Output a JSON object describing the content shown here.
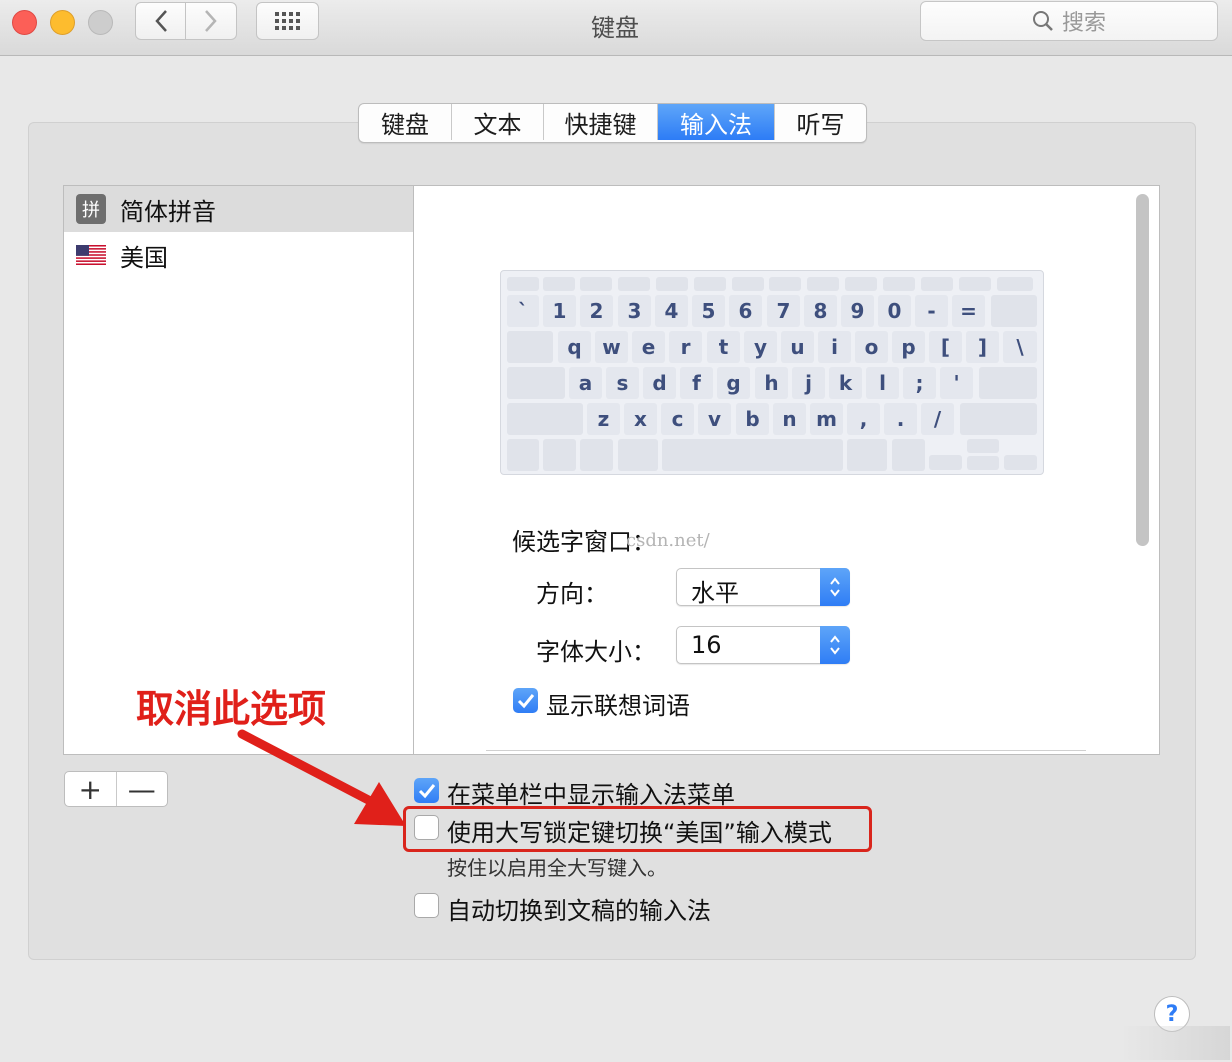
{
  "window": {
    "title": "键盘"
  },
  "search": {
    "placeholder": "搜索"
  },
  "tabs": [
    {
      "label": "键盘"
    },
    {
      "label": "文本"
    },
    {
      "label": "快捷键"
    },
    {
      "label": "输入法"
    },
    {
      "label": "听写"
    }
  ],
  "active_tab": "输入法",
  "input_sources": [
    {
      "icon": "pinyin-icon",
      "icon_text": "拼",
      "label": "简体拼音",
      "selected": true
    },
    {
      "icon": "us-flag-icon",
      "label": "美国",
      "selected": false
    }
  ],
  "keyboard": {
    "row1": [
      "`",
      "1",
      "2",
      "3",
      "4",
      "5",
      "6",
      "7",
      "8",
      "9",
      "0",
      "-",
      "="
    ],
    "row2": [
      "q",
      "w",
      "e",
      "r",
      "t",
      "y",
      "u",
      "i",
      "o",
      "p",
      "[",
      "]",
      "\\"
    ],
    "row3": [
      "a",
      "s",
      "d",
      "f",
      "g",
      "h",
      "j",
      "k",
      "l",
      ";",
      "'"
    ],
    "row4": [
      "z",
      "x",
      "c",
      "v",
      "b",
      "n",
      "m",
      ",",
      ".",
      "/"
    ]
  },
  "candidate_window": {
    "label": "候选字窗口：",
    "direction_label": "方向：",
    "direction_value": "水平",
    "font_size_label": "字体大小：",
    "font_size_value": "16",
    "show_associated_label": "显示联想词语",
    "show_associated_checked": true
  },
  "watermark": "csdn.net/",
  "list_buttons": {
    "add": "+",
    "remove": "—"
  },
  "options": [
    {
      "label": "在菜单栏中显示输入法菜单",
      "checked": true
    },
    {
      "label": "使用大写锁定键切换“美国”输入模式",
      "checked": false,
      "hint": "按住以启用全大写键入。"
    },
    {
      "label": "自动切换到文稿的输入法",
      "checked": false
    }
  ],
  "annotation": {
    "text": "取消此选项",
    "color": "#e0201a"
  },
  "help": {
    "label": "?"
  },
  "colors": {
    "accent": "#2d7cf6",
    "highlight": "#d9251c"
  }
}
